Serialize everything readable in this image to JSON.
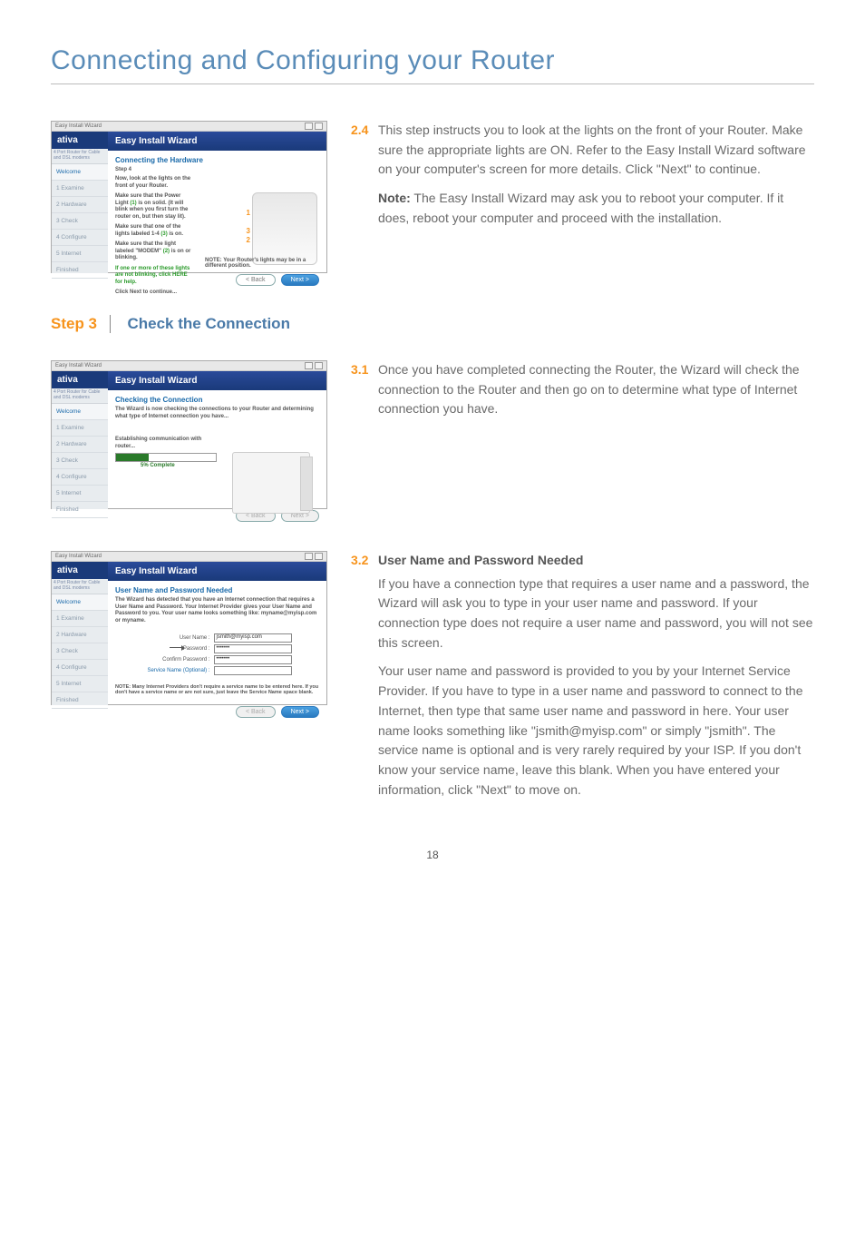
{
  "page_title": "Connecting and Configuring your Router",
  "page_number": "18",
  "step24": {
    "num": "2.4",
    "body": "This step instructs you to look at the lights on the front of your Router. Make sure the appropriate lights are ON. Refer to the Easy Install Wizard software on your computer's screen for more details. Click \"Next\" to continue.",
    "note_label": "Note:",
    "note": " The Easy Install Wizard may ask you to reboot your computer. If it does, reboot your computer and proceed with the installation."
  },
  "step3_header": {
    "num": "Step 3",
    "label": "Check the Connection"
  },
  "step31": {
    "num": "3.1",
    "body": "Once you have completed connecting the Router, the Wizard will check the connection to the Router and then go on to determine what type of Internet connection you have."
  },
  "step32": {
    "num": "3.2",
    "heading": "User Name and Password Needed",
    "p1": "If you have a connection type that requires a user name and a password, the Wizard will ask you to type in your user name and password. If your connection type does not require a user name and password, you will not see this screen.",
    "p2": "Your user name and password is provided to you by your Internet Service Provider. If you have to type in a user name and password to connect to the Internet, then type that same user name and password in here. Your user name looks something like \"jsmith@myisp.com\" or simply \"jsmith\". The service name is optional and is very rarely required by your ISP. If you don't know your service name, leave this blank. When you have entered your information, click \"Next\" to move on."
  },
  "wizard_common": {
    "window_title": "Easy Install Wizard",
    "brand": "ativa",
    "brand_sub": "4 Port Router for Cable and DSL modems",
    "banner": "Easy Install Wizard",
    "btn_back": "< Back",
    "btn_next": "Next >"
  },
  "sidebar_items": [
    "Welcome",
    "1 Examine",
    "2 Hardware",
    "3 Check",
    "4 Configure",
    "5 Internet",
    "Finished"
  ],
  "wizardA": {
    "heading": "Connecting the Hardware",
    "sub": "Step 4",
    "l1": "Now, look at the lights on the front of your Router.",
    "l2a": "Make sure that the Power Light ",
    "l2b": "(1)",
    "l2c": " is on solid. (It will blink when you first turn the router on, but then stay lit).",
    "l3a": "Make sure that one of the lights labeled 1-4 ",
    "l3b": "(3)",
    "l3c": " is on.",
    "l4a": "Make sure that the light labeled \"MODEM\" ",
    "l4b": "(2)",
    "l4c": " is on or blinking.",
    "l5a": "If one or more of these lights are not blinking, click ",
    "l5b": "HERE",
    "l5c": " for help.",
    "l6": "Click Next to continue...",
    "note": "NOTE: Your Router's lights may be in a different position.",
    "n1": "1",
    "n2": "2",
    "n3": "3"
  },
  "wizardB": {
    "heading": "Checking the Connection",
    "desc": "The Wizard is now checking the connections to your Router and determining what type of Internet connection you have...",
    "est": "Establishing communication with router...",
    "pct": "5% Complete"
  },
  "wizardC": {
    "heading": "User Name and Password Needed",
    "desc": "The Wizard has detected that you have an Internet connection that requires a User Name and Password. Your Internet Provider gives your User Name and Password to you. Your user name looks something like: myname@myisp.com or myname.",
    "lbl_user": "User Name :",
    "lbl_pass": "Password :",
    "lbl_conf": "Confirm Password :",
    "lbl_serv": "Service Name (Optional) :",
    "val_user": "jsmith@myisp.com",
    "val_mask": "•••••••",
    "note": "NOTE: Many Internet Providers don't require a service name to be entered here. If you don't have a service name or are not sure, just leave the Service Name space blank."
  }
}
